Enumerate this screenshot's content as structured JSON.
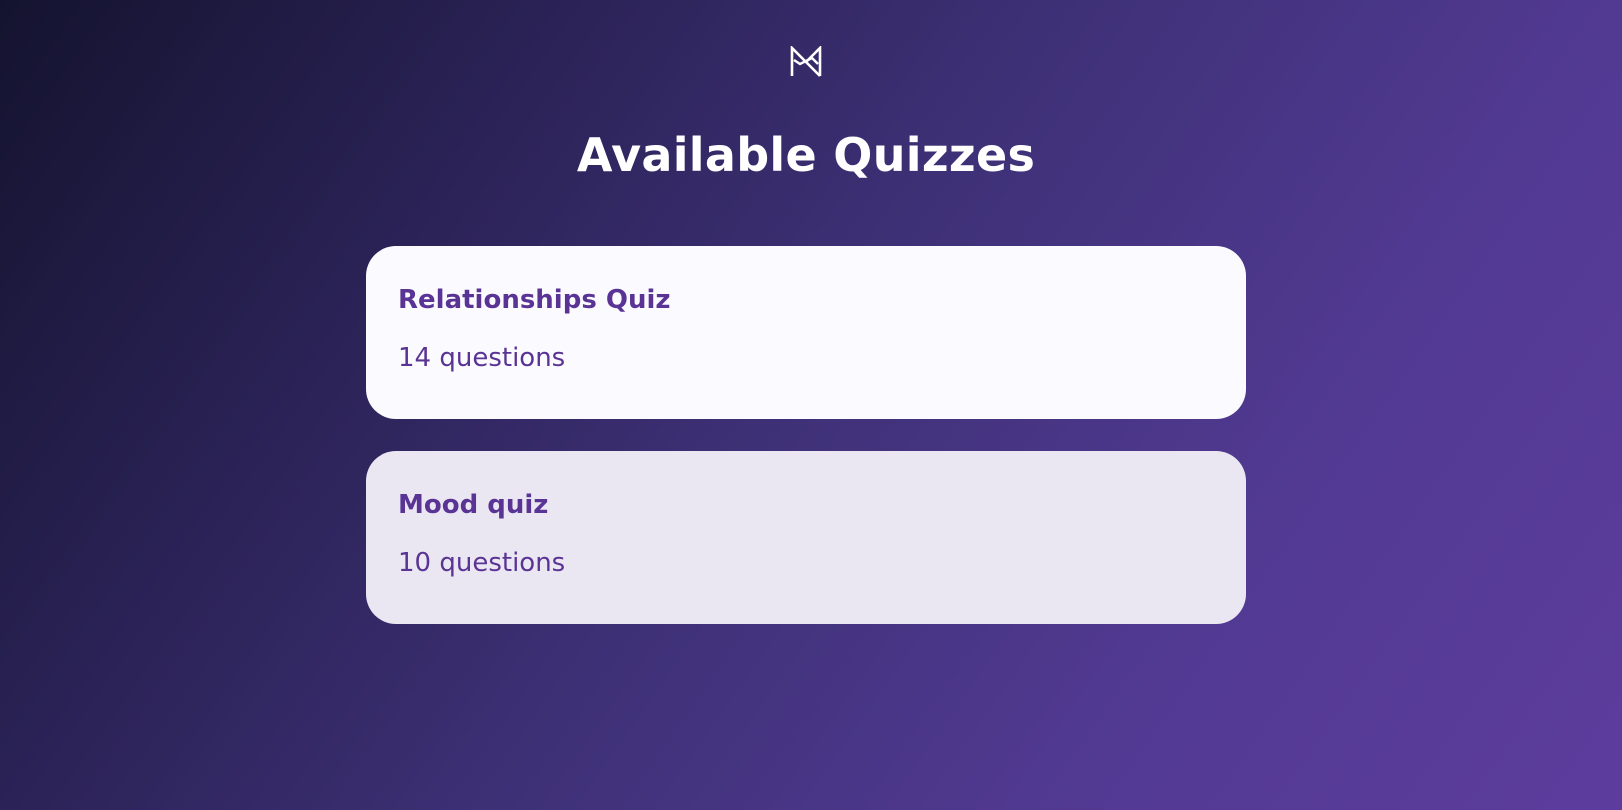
{
  "header": {
    "logo_icon": "n-logo-icon",
    "title": "Available Quizzes"
  },
  "theme": {
    "accent": "#5a3495",
    "card_active_bg": "#fbfaff",
    "card_inactive_bg": "#eae7f2"
  },
  "quizzes": [
    {
      "name": "Relationships Quiz",
      "count": "14 questions"
    },
    {
      "name": "Mood quiz",
      "count": "10 questions"
    }
  ]
}
